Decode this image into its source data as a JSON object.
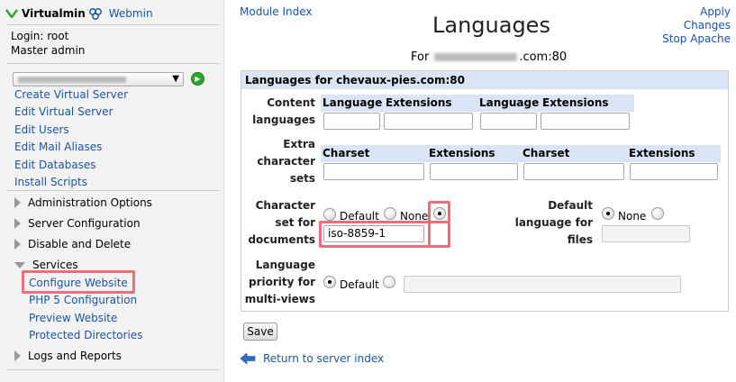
{
  "sidebar": {
    "brand": "Virtualmin",
    "webmin": "Webmin",
    "login": "Login: root",
    "role": "Master admin",
    "links": [
      "Create Virtual Server",
      "Edit Virtual Server",
      "Edit Users",
      "Edit Mail Aliases",
      "Edit Databases",
      "Install Scripts"
    ],
    "categories": {
      "admin": "Administration Options",
      "server": "Server Configuration",
      "disable": "Disable and Delete",
      "services": "Services",
      "logs": "Logs and Reports"
    },
    "service_links": [
      "Configure Website",
      "PHP 5 Configuration",
      "Preview Website",
      "Protected Directories"
    ]
  },
  "main": {
    "module_index": "Module Index",
    "apply_changes_1": "Apply",
    "apply_changes_2": "Changes",
    "stop_apache": "Stop Apache",
    "title": "Languages",
    "for_prefix": "For",
    "for_suffix": ".com:80",
    "panel_title": "Languages for chevaux-pies.com:80",
    "content_languages_label_1": "Content",
    "content_languages_label_2": "languages",
    "col_language": "Language",
    "col_extensions": "Extensions",
    "extra_charsets_label_1": "Extra",
    "extra_charsets_label_2": "character",
    "extra_charsets_label_3": "sets",
    "col_charset": "Charset",
    "charset_docs_label_1": "Character",
    "charset_docs_label_2": "set for",
    "charset_docs_label_3": "documents",
    "opt_default": "Default",
    "opt_none": "None",
    "charset_value": "iso-8859-1",
    "default_lang_label_1": "Default",
    "default_lang_label_2": "language for",
    "default_lang_label_3": "files",
    "lang_priority_label_1": "Language",
    "lang_priority_label_2": "priority for",
    "lang_priority_label_3": "multi-views",
    "save": "Save",
    "return": "Return to server index"
  },
  "colors": {
    "link": "#1a56a6",
    "header_bg": "#d9e5f5",
    "highlight": "#f06b7b",
    "go_button": "#2ea62e"
  }
}
